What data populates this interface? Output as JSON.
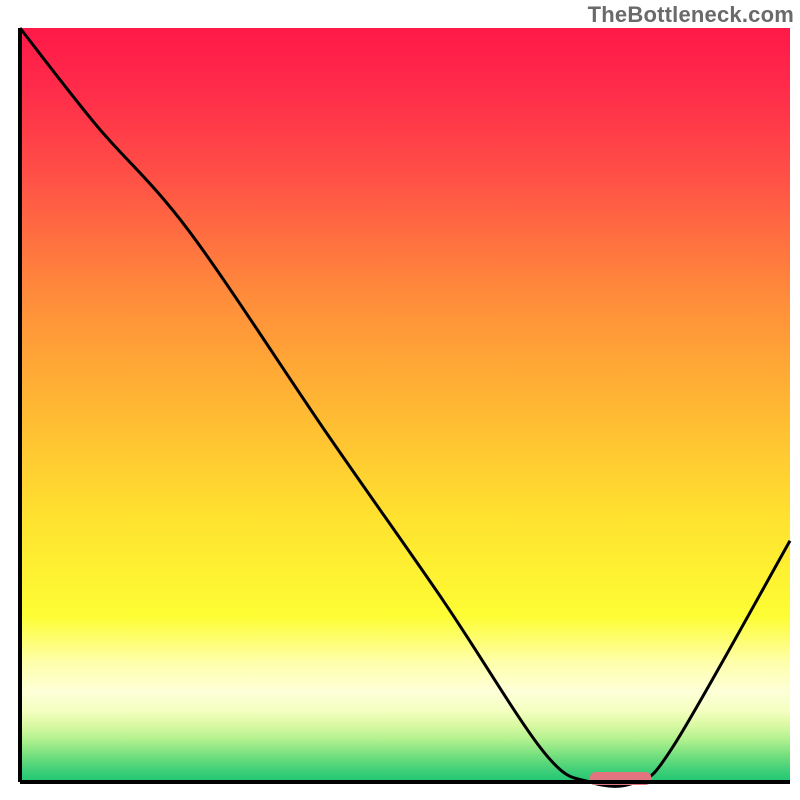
{
  "watermark": "TheBottleneck.com",
  "chart_data": {
    "type": "line",
    "title": "",
    "xlabel": "",
    "ylabel": "",
    "xlim": [
      0,
      100
    ],
    "ylim": [
      0,
      100
    ],
    "grid": false,
    "series": [
      {
        "name": "bottleneck-curve",
        "x": [
          0,
          10,
          22,
          40,
          55,
          68,
          74,
          80,
          85,
          100
        ],
        "y": [
          100,
          87,
          73,
          46,
          24,
          4,
          0,
          0,
          5,
          32
        ]
      }
    ],
    "marker": {
      "name": "optimal-range",
      "x_start": 74,
      "x_end": 82,
      "y": 0,
      "color": "#e2747f"
    },
    "background": {
      "type": "vertical-gradient",
      "stops": [
        {
          "offset": 0.0,
          "color": "#ff1948"
        },
        {
          "offset": 0.08,
          "color": "#ff2b4a"
        },
        {
          "offset": 0.2,
          "color": "#ff5146"
        },
        {
          "offset": 0.35,
          "color": "#ff8a3b"
        },
        {
          "offset": 0.5,
          "color": "#ffb733"
        },
        {
          "offset": 0.65,
          "color": "#ffe22f"
        },
        {
          "offset": 0.78,
          "color": "#fdfd34"
        },
        {
          "offset": 0.84,
          "color": "#feffa8"
        },
        {
          "offset": 0.88,
          "color": "#fdffd8"
        },
        {
          "offset": 0.905,
          "color": "#f5ffc1"
        },
        {
          "offset": 0.925,
          "color": "#d9f9a2"
        },
        {
          "offset": 0.945,
          "color": "#aef08d"
        },
        {
          "offset": 0.965,
          "color": "#74df7e"
        },
        {
          "offset": 0.985,
          "color": "#3ecf78"
        },
        {
          "offset": 1.0,
          "color": "#1fc673"
        }
      ]
    }
  }
}
